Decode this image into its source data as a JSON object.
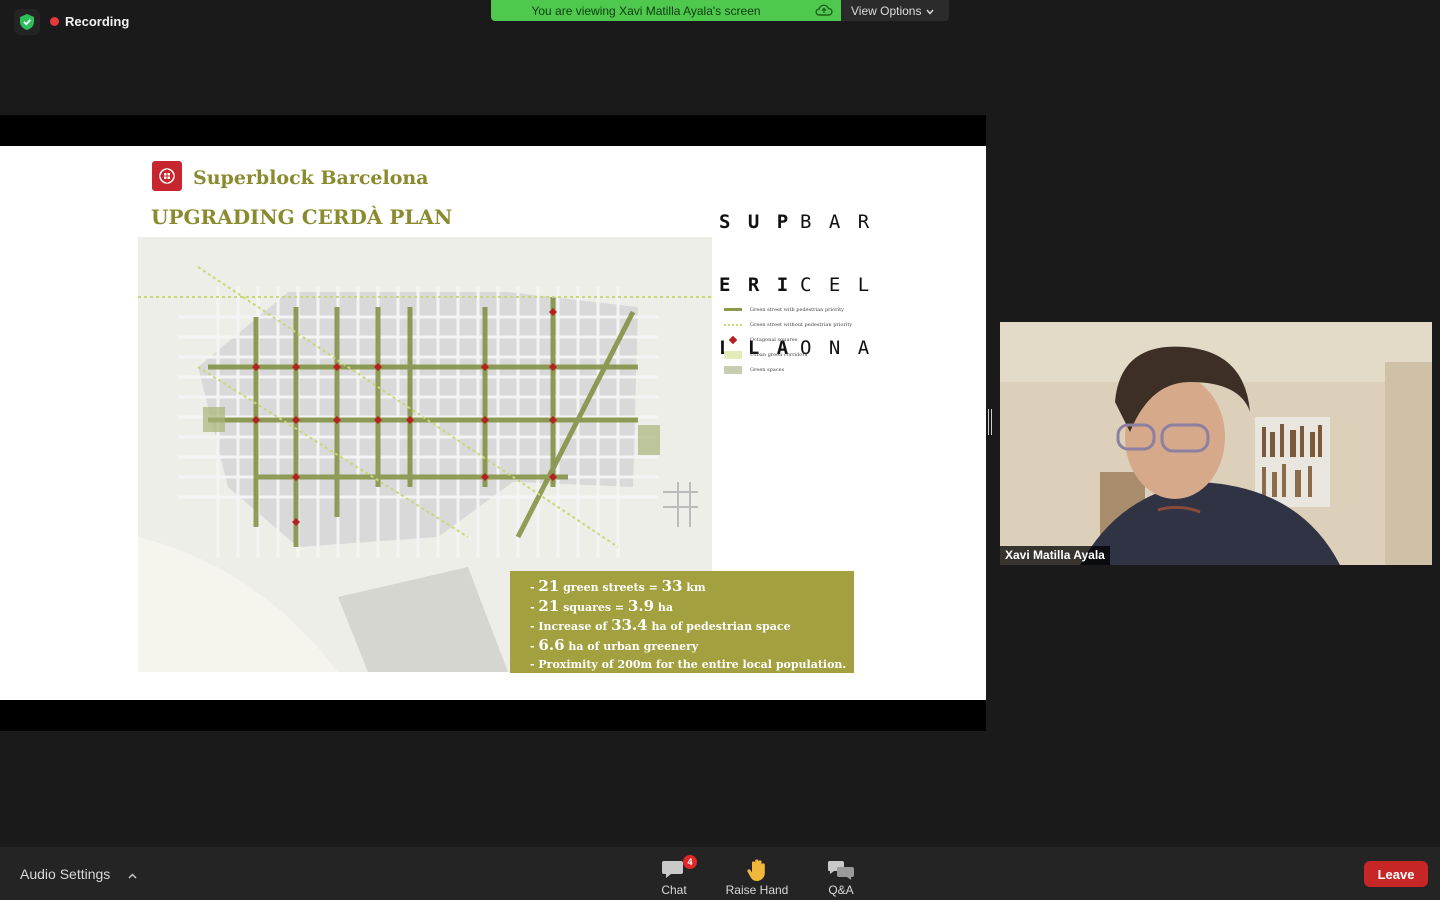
{
  "top_bar": {
    "recording_label": "Recording",
    "viewing_banner": "You are viewing Xavi Matilla Ayala's screen",
    "view_options_label": "View Options"
  },
  "slide": {
    "title": "Superblock Barcelona",
    "subtitle": "UPGRADING CERDÀ PLAN",
    "brand_left": [
      "S U P",
      "E R I",
      "L L A"
    ],
    "brand_right": [
      "B A R",
      "C E L",
      "O N A"
    ],
    "legend": [
      {
        "label": "Green street with pedestrian priority",
        "color": "#8a9a4a"
      },
      {
        "label": "Green street without pedestrian priority",
        "color": "#c9d67a"
      },
      {
        "label": "Octagonal squares",
        "color": "#b52020"
      },
      {
        "label": "Urban green corridors",
        "color": "#e3ebb8"
      },
      {
        "label": "Green spaces",
        "color": "#c6cdb0"
      }
    ],
    "stats": [
      {
        "pre": "- ",
        "big": "21",
        "mid": " green streets = ",
        "big2": "33",
        "post": " km"
      },
      {
        "pre": "- ",
        "big": "21",
        "mid": " squares = ",
        "big2": "3.9",
        "post": " ha"
      },
      {
        "pre": "- Increase of ",
        "big": "33.4",
        "mid": " ha of pedestrian space",
        "big2": "",
        "post": ""
      },
      {
        "pre": "- ",
        "big": "6.6",
        "mid": " ha of urban greenery",
        "big2": "",
        "post": ""
      },
      {
        "pre": "- Proximity of 200m for the entire local population.",
        "big": "",
        "mid": "",
        "big2": "",
        "post": ""
      }
    ]
  },
  "video": {
    "participant_name": "Xavi Matilla Ayala"
  },
  "bottom_bar": {
    "audio_settings_label": "Audio Settings",
    "chat_label": "Chat",
    "chat_badge": "4",
    "raise_hand_label": "Raise Hand",
    "qa_label": "Q&A",
    "leave_label": "Leave"
  },
  "colors": {
    "accent_green": "#4ec94e",
    "slide_olive": "#8a8a2e",
    "stats_bg": "#a3a13f",
    "leave_red": "#c72626"
  }
}
